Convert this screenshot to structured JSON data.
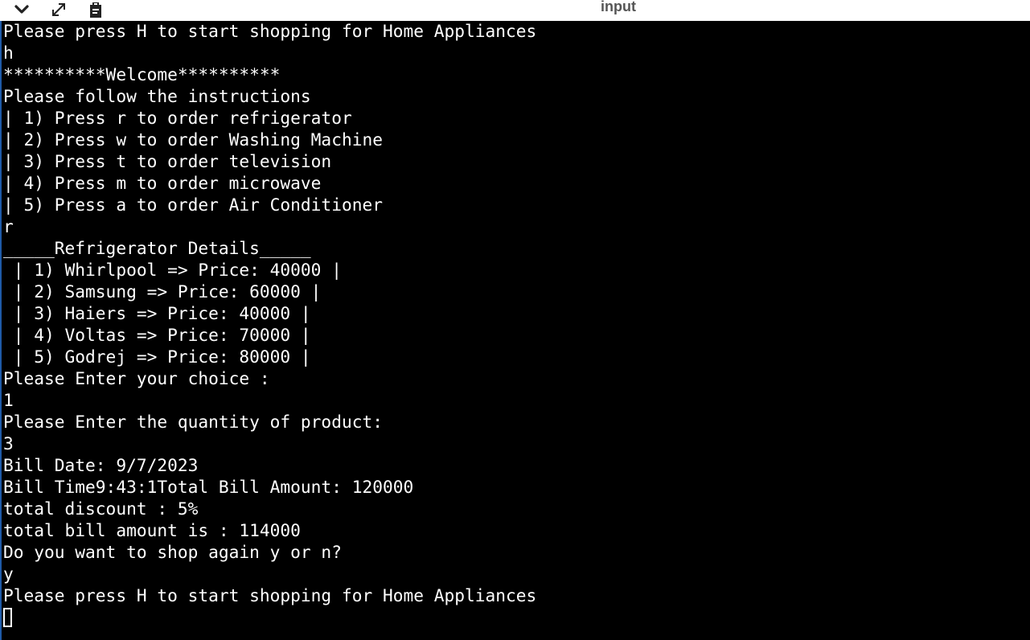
{
  "toolbar": {
    "title": "input",
    "icons": [
      "chevron-down-icon",
      "expand-icon",
      "clipboard-icon"
    ]
  },
  "terminal": {
    "lines": [
      "Please press H to start shopping for Home Appliances",
      "h",
      "**********Welcome**********",
      "Please follow the instructions",
      "| 1) Press r to order refrigerator",
      "| 2) Press w to order Washing Machine",
      "| 3) Press t to order television",
      "| 4) Press m to order microwave",
      "| 5) Press a to order Air Conditioner",
      "r",
      "_____Refrigerator Details_____",
      " | 1) Whirlpool => Price: 40000 |",
      " | 2) Samsung => Price: 60000 |",
      " | 3) Haiers => Price: 40000 |",
      " | 4) Voltas => Price: 70000 |",
      " | 5) Godrej => Price: 80000 |",
      "Please Enter your choice :",
      "1",
      "Please Enter the quantity of product:",
      "3",
      "Bill Date: 9/7/2023",
      "Bill Time9:43:1Total Bill Amount: 120000",
      "total discount : 5%",
      "total bill amount is : 114000",
      "Do you want to shop again y or n?",
      "y",
      "Please press H to start shopping for Home Appliances"
    ]
  },
  "colors": {
    "background": "#000000",
    "text": "#ffffff",
    "toolbar": "#ffffff",
    "accent": "#1e5aa8"
  }
}
